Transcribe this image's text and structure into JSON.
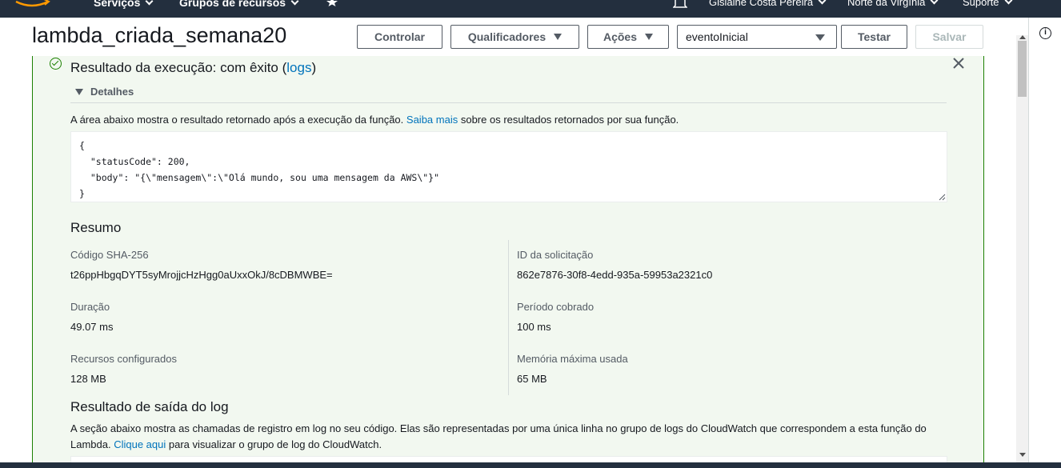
{
  "nav": {
    "services": "Serviços",
    "resource_groups": "Grupos de recursos",
    "user": "Gislaine Costa Pereira",
    "region": "Norte da Virgínia",
    "support": "Suporte"
  },
  "header": {
    "title": "lambda_criada_semana20",
    "controlar": "Controlar",
    "qualificadores": "Qualificadores",
    "acoes": "Ações",
    "event_selected": "eventoInicial",
    "testar": "Testar",
    "salvar": "Salvar"
  },
  "result": {
    "title": "Resultado da execução: com êxito (",
    "logs_link": "logs",
    "title_end": ")",
    "details": "Detalhes",
    "desc_pre": "A área abaixo mostra o resultado retornado após a execução da função.",
    "saiba_mais": "Saiba mais",
    "desc_post": "sobre os resultados retornados por sua função.",
    "output": "{\n  \"statusCode\": 200,\n  \"body\": \"{\\\"mensagem\\\":\\\"Olá mundo, sou uma mensagem da AWS\\\"}\"\n}"
  },
  "summary": {
    "title": "Resumo",
    "sha_label": "Código SHA-256",
    "sha_value": "t26ppHbgqDYT5syMrojjcHzHgg0aUxxOkJ/8cDBMWBE=",
    "request_label": "ID da solicitação",
    "request_value": "862e7876-30f8-4edd-935a-59953a2321c0",
    "duration_label": "Duração",
    "duration_value": "49.07 ms",
    "billed_label": "Período cobrado",
    "billed_value": "100 ms",
    "resources_label": "Recursos configurados",
    "resources_value": "128 MB",
    "memory_label": "Memória máxima usada",
    "memory_value": "65 MB"
  },
  "log": {
    "title": "Resultado de saída do log",
    "desc_pre": "A seção abaixo mostra as chamadas de registro em log no seu código. Elas são representadas por uma única linha no grupo de logs do CloudWatch que correspondem a esta função do Lambda.",
    "clique_aqui": "Clique aqui",
    "desc_post": "para visualizar o grupo de log do CloudWatch."
  },
  "colors": {
    "nav_bg": "#232f3e",
    "success": "#1d8102",
    "success_bg": "#f2f8f0",
    "link": "#0073bb"
  },
  "icons": [
    "aws-logo-icon",
    "star-icon",
    "bell-icon",
    "info-icon",
    "check-circle-icon",
    "close-icon",
    "caret-down-icon"
  ]
}
